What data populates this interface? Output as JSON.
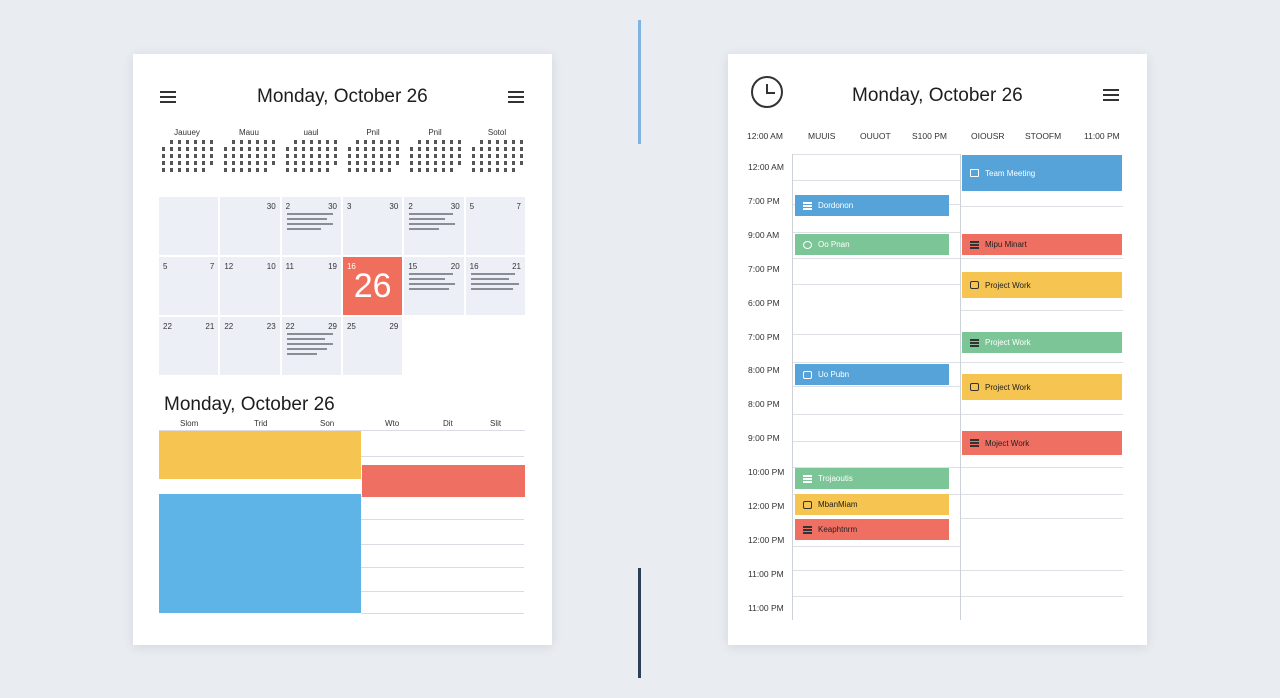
{
  "colors": {
    "blue": "#55a3d8",
    "green": "#7cc596",
    "red": "#ef7062",
    "yellow": "#f6c451",
    "today": "#ef6f5c"
  },
  "left_card": {
    "title": "Monday, October 26",
    "menu_icon": "hamburger-icon",
    "mini_months": [
      "Jauuey",
      "Mauu",
      "uaul",
      "Pnil",
      "Pnil",
      "Sotol"
    ],
    "month_cells": [
      {
        "left": "",
        "right": ""
      },
      {
        "left": "",
        "right": "30"
      },
      {
        "left": "2",
        "right": "30"
      },
      {
        "left": "3",
        "right": "30"
      },
      {
        "left": "2",
        "right": "30"
      },
      {
        "left": "5",
        "right": "7"
      },
      {
        "left": "5",
        "right": "7"
      },
      {
        "left": "12",
        "right": "10"
      },
      {
        "left": "11",
        "right": "19"
      },
      {
        "left": "16",
        "right": "",
        "big": "26"
      },
      {
        "left": "15",
        "right": "20"
      },
      {
        "left": "16",
        "right": "21"
      },
      {
        "left": "22",
        "right": "21"
      },
      {
        "left": "22",
        "right": "23"
      },
      {
        "left": "22",
        "right": "29"
      },
      {
        "left": "25",
        "right": "29"
      }
    ],
    "week_title": "Monday, October 26",
    "week_headers": [
      "Slom",
      "Trid",
      "Son",
      "Wto",
      "Dit",
      "Slit"
    ]
  },
  "right_card": {
    "title": "Monday, October 26",
    "clock_icon": "clock-icon",
    "menu_icon": "hamburger-icon",
    "column_headers": [
      "12:00 AM",
      "MUUIS",
      "OUUOT",
      "S100 PM",
      "OIOUSR",
      "STOOFM",
      "11:00 PM"
    ],
    "time_labels": [
      "12:00 AM",
      "7:00 PM",
      "9:00 AM",
      "7:00 PM",
      "6:00 PM",
      "7:00 PM",
      "8:00 PM",
      "8:00 PM",
      "9:00 PM",
      "10:00 PM",
      "12:00 PM",
      "12:00 PM",
      "11:00 PM",
      "11:00 PM"
    ],
    "events": [
      {
        "label": "Team Meeting",
        "color": "blue",
        "icon": "document-icon"
      },
      {
        "label": "Dordonon",
        "color": "blue",
        "icon": "list-icon"
      },
      {
        "label": "Oo Pnan",
        "color": "green",
        "icon": "pin-icon"
      },
      {
        "label": "Mipu Minart",
        "color": "red",
        "icon": "list-icon"
      },
      {
        "label": "Project Work",
        "color": "yellow",
        "icon": "chat-icon"
      },
      {
        "label": "Project Work",
        "color": "green",
        "icon": "list-icon"
      },
      {
        "label": "Uo Pubn",
        "color": "blue",
        "icon": "note-icon"
      },
      {
        "label": "Project Work",
        "color": "yellow",
        "icon": "note-icon"
      },
      {
        "label": "Moject Work",
        "color": "red",
        "icon": "list-icon"
      },
      {
        "label": "Trojaoutis",
        "color": "green",
        "icon": "list-icon"
      },
      {
        "label": "MbanMiam",
        "color": "yellow",
        "icon": "chat-icon"
      },
      {
        "label": "Keaphtnrm",
        "color": "red",
        "icon": "list-icon"
      }
    ]
  }
}
